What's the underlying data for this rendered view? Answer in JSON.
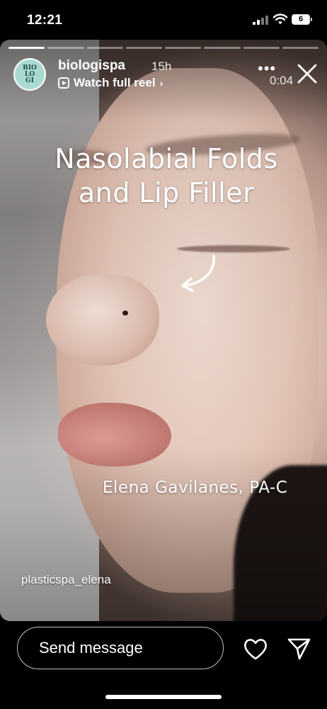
{
  "status_bar": {
    "time": "12:21",
    "battery_level": "6"
  },
  "story": {
    "username": "biologispa",
    "posted_ago": "15h",
    "watch_reel_label": "Watch full reel",
    "timer": "0:04",
    "avatar_text": "BIO LO GI",
    "segments_total": 8,
    "segment_active_index": 0,
    "overlay_title_line1": "Nasolabial Folds",
    "overlay_title_line2": "and Lip Filler",
    "credit": "Elena Gavilanes, PA-C",
    "tagged_handle": "plasticspa_elena",
    "icons": {
      "more": "more-icon",
      "close": "close-icon",
      "reel": "reel-icon",
      "arrow": "curved-arrow-icon"
    }
  },
  "footer": {
    "message_placeholder": "Send message",
    "like_icon": "heart-icon",
    "send_icon": "send-icon"
  },
  "colors": {
    "background": "#000000",
    "text": "#ffffff"
  }
}
